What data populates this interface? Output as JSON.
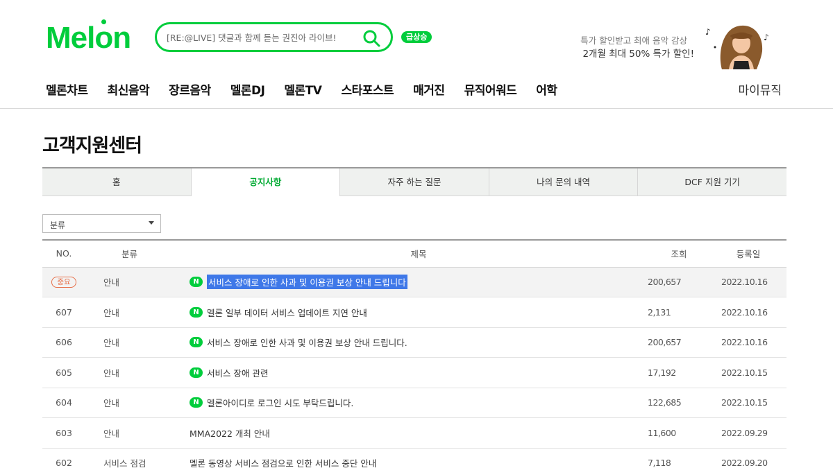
{
  "header": {
    "logo_text": "Melon",
    "search": {
      "placeholder": "[RE:@LIVE] 댓글과 함께 듣는 권진아 라이브!"
    },
    "trend_badge": "급상승",
    "promo": {
      "line1": "특가 할인받고 최애 음악 감상",
      "line2": "2개월 최대 50% 특가 할인!"
    },
    "nav": [
      {
        "label": "멜론차트"
      },
      {
        "label": "최신음악"
      },
      {
        "label": "장르음악"
      },
      {
        "label": "멜론DJ"
      },
      {
        "label": "멜론TV"
      },
      {
        "label": "스타포스트"
      },
      {
        "label": "매거진"
      },
      {
        "label": "뮤직어워드"
      },
      {
        "label": "어학"
      }
    ],
    "my_music": "마이뮤직"
  },
  "page": {
    "title": "고객지원센터",
    "tabs": [
      {
        "label": "홈",
        "active": false
      },
      {
        "label": "공지사항",
        "active": true
      },
      {
        "label": "자주 하는 질문",
        "active": false
      },
      {
        "label": "나의 문의 내역",
        "active": false
      },
      {
        "label": "DCF 지원 기기",
        "active": false
      }
    ],
    "category_select": {
      "value": "분류"
    },
    "table": {
      "headers": {
        "no": "NO.",
        "category": "분류",
        "title": "제목",
        "views": "조회",
        "date": "등록일"
      },
      "rows": [
        {
          "no": "",
          "badge": "중요",
          "category": "안내",
          "new": "N",
          "title": "서비스 장애로 인한 사과 및 이용권 보상 안내 드립니다",
          "views": "200,657",
          "date": "2022.10.16"
        },
        {
          "no": "607",
          "category": "안내",
          "new": "N",
          "title": "멜론 일부 데이터 서비스 업데이트 지연 안내",
          "views": "2,131",
          "date": "2022.10.16"
        },
        {
          "no": "606",
          "category": "안내",
          "new": "N",
          "title": "서비스 장애로 인한 사과 및 이용권 보상 안내 드립니다.",
          "views": "200,657",
          "date": "2022.10.16"
        },
        {
          "no": "605",
          "category": "안내",
          "new": "N",
          "title": "서비스 장애 관련",
          "views": "17,192",
          "date": "2022.10.15"
        },
        {
          "no": "604",
          "category": "안내",
          "new": "N",
          "title": "멜론아이디로 로그인 시도 부탁드립니다.",
          "views": "122,685",
          "date": "2022.10.15"
        },
        {
          "no": "603",
          "category": "안내",
          "title": "MMA2022 개최 안내",
          "views": "11,600",
          "date": "2022.09.29"
        },
        {
          "no": "602",
          "category": "서비스 점검",
          "title": "멜론 동영상 서비스 점검으로 인한 서비스 중단 안내",
          "views": "7,118",
          "date": "2022.09.20"
        }
      ]
    }
  },
  "colors": {
    "brand_green": "#00cd3c",
    "selection_blue": "#3f78e8",
    "important_orange": "#e7704a"
  },
  "icons": {
    "search": "search-icon",
    "dropdown": "caret-down-icon"
  }
}
